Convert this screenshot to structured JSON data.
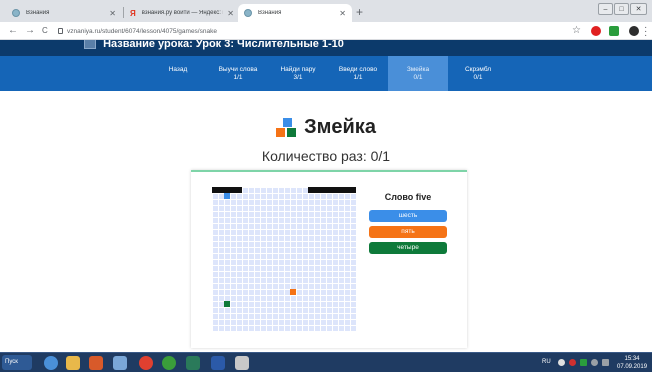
{
  "browser": {
    "tabs": [
      {
        "label": "Взнания",
        "active": false
      },
      {
        "label": "взнания.ру войти — Яндекс: нашл",
        "active": false
      },
      {
        "label": "Взнания",
        "active": true
      }
    ],
    "new_tab": "+",
    "window_controls": [
      "–",
      "□",
      "✕"
    ],
    "url": "vznaniya.ru/student/6074/lesson/4075/games/snake",
    "nav": {
      "back": "←",
      "forward": "→",
      "reload": "C"
    },
    "star": "☆"
  },
  "site": {
    "title": "Название урока: Урок 3: Числительные 1-10",
    "nav_items": [
      {
        "label": "Назад",
        "count": "",
        "active": false
      },
      {
        "label": "Выучи слова",
        "count": "1/1",
        "active": false
      },
      {
        "label": "Найди пару",
        "count": "3/1",
        "active": false
      },
      {
        "label": "Введи слово",
        "count": "1/1",
        "active": false
      },
      {
        "label": "Змейка",
        "count": "0/1",
        "active": true
      },
      {
        "label": "Скрэмбл",
        "count": "0/1",
        "active": false
      }
    ]
  },
  "game": {
    "title": "Змейка",
    "counter": "Количество раз: 0/1",
    "word_label": "Слово five",
    "answers": [
      {
        "label": "шесть",
        "color": "#3b8ee8"
      },
      {
        "label": "пять",
        "color": "#f57316"
      },
      {
        "label": "четыре",
        "color": "#0e7a3a"
      }
    ],
    "board": {
      "grid_cols": 24,
      "grid_rows": 24,
      "walls": [
        [
          0,
          0
        ],
        [
          1,
          0
        ],
        [
          2,
          0
        ],
        [
          3,
          0
        ],
        [
          4,
          0
        ],
        [
          16,
          0
        ],
        [
          17,
          0
        ],
        [
          18,
          0
        ],
        [
          19,
          0
        ],
        [
          20,
          0
        ],
        [
          21,
          0
        ],
        [
          22,
          0
        ],
        [
          23,
          0
        ]
      ],
      "snake": [
        [
          2,
          1
        ]
      ],
      "snake_color": "#3b8ee8",
      "food": [
        {
          "col": 2,
          "row": 19,
          "color": "#0e7a3a"
        },
        {
          "col": 13,
          "row": 17,
          "color": "#f57316"
        }
      ]
    }
  },
  "taskbar": {
    "start_label": "Пуск",
    "language": "RU",
    "time": "15:34",
    "date": "07.09.2019"
  }
}
